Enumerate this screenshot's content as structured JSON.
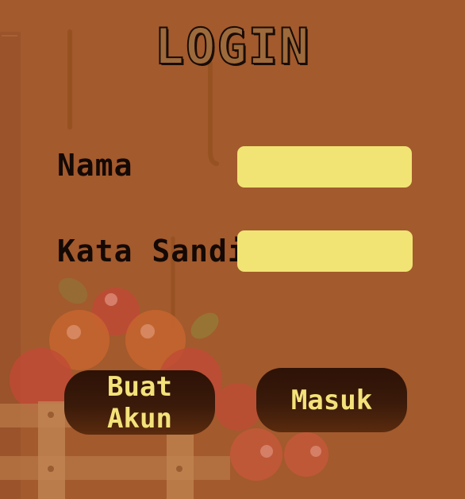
{
  "title": "LOGIN",
  "form": {
    "name_label": "Nama",
    "name_value": "",
    "password_label": "Kata Sandi",
    "password_value": ""
  },
  "buttons": {
    "create_account": "Buat Akun",
    "login": "Masuk"
  },
  "colors": {
    "background": "#a35a2d",
    "input_fill": "#f1e474",
    "button_fill": "#3a1a0a",
    "button_text": "#f3e27a",
    "label_text": "#140904"
  }
}
